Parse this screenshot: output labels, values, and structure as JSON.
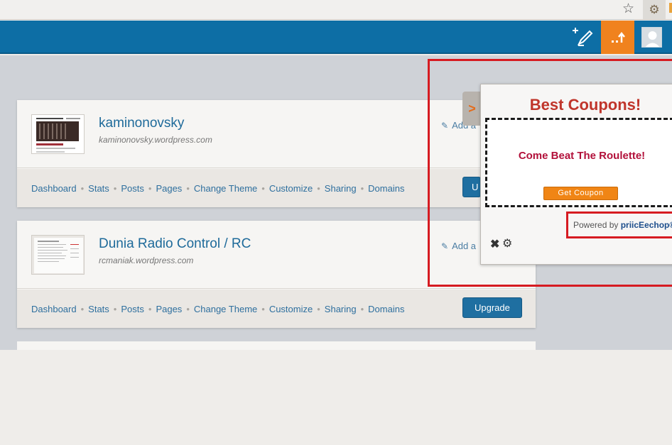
{
  "browser": {
    "star_icon": "star-icon",
    "extension_icon": "gear-icon"
  },
  "admin_bar": {
    "color": "#0d6ea5",
    "notification_color": "#f0821e",
    "icons": [
      "write-post-icon",
      "notifications-icon",
      "avatar"
    ]
  },
  "sites": [
    {
      "name": "kaminonovsky",
      "url": "kaminonovsky.wordpress.com",
      "add_label": "Add a",
      "upgrade_label": "U"
    },
    {
      "name": "Dunia Radio Control / RC",
      "url": "rcmaniak.wordpress.com",
      "add_label": "Add a",
      "upgrade_label": "Upgrade"
    }
  ],
  "site_links": [
    "Dashboard",
    "Stats",
    "Posts",
    "Pages",
    "Change Theme",
    "Customize",
    "Sharing",
    "Domains"
  ],
  "popup": {
    "tab_glyph": ">",
    "title": "Best Coupons!",
    "coupon_text": "Come Beat The Roulette!",
    "coupon_button": "Get Coupon",
    "powered_prefix": "Powered by ",
    "powered_brand": "priicEechop®",
    "highlight_color": "#d61b21"
  }
}
